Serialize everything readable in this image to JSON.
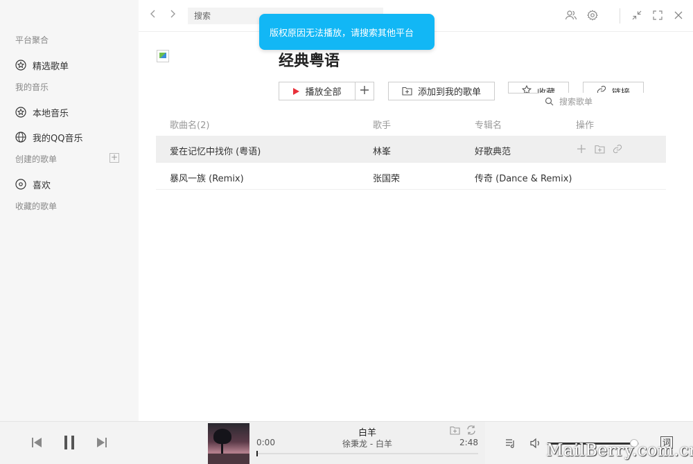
{
  "sidebar": {
    "group_platform": "平台聚合",
    "featured": "精选歌单",
    "group_my_music": "我的音乐",
    "local_music": "本地音乐",
    "my_qq_music": "我的QQ音乐",
    "group_created": "创建的歌单",
    "add_label": "+",
    "likes": "喜欢",
    "group_collected": "收藏的歌单"
  },
  "topbar": {
    "search_placeholder": "搜索"
  },
  "toast": {
    "message": "版权原因无法播放，请搜索其他平台"
  },
  "playlist": {
    "title": "经典粤语",
    "play_all": "播放全部",
    "plus": "+",
    "add_to_my": "添加到我的歌单",
    "favorite": "收藏",
    "link": "链接",
    "search_songs_placeholder": "搜索歌单"
  },
  "table": {
    "headers": {
      "name": "歌曲名(2)",
      "artist": "歌手",
      "album": "专辑名",
      "ops": "操作"
    },
    "rows": [
      {
        "name": "爱在记忆中找你 (粤语)",
        "artist": "林峯",
        "album": "好歌典范"
      },
      {
        "name": "暴风一族 (Remix)",
        "artist": "张国荣",
        "album": "传奇 (Dance & Remix)"
      }
    ]
  },
  "player": {
    "title": "白羊",
    "subtitle": "徐秉龙 - 白羊",
    "current_time": "0:00",
    "total_time": "2:48",
    "progress": 0,
    "volume": 0.95,
    "lyric_label": "词"
  },
  "watermark": "MailBerry.com.cn",
  "colors": {
    "toast_bg": "#12b7f5",
    "play_icon": "#e8303a",
    "sidebar_bg": "#f6f6f6"
  }
}
